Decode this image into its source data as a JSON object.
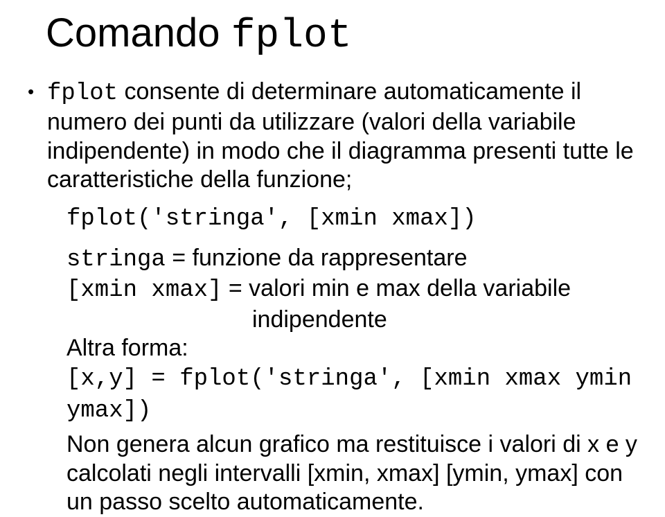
{
  "title_prefix": "Comando ",
  "title_code": "fplot",
  "bullet": {
    "lead_code": "fplot",
    "lead_rest": " consente di determinare automaticamente il numero dei punti da utilizzare (valori della variabile indipendente) in modo che il diagramma presenti tutte le caratteristiche della funzione;",
    "syntax1": "fplot('stringa', [xmin xmax])",
    "stringa_code": "stringa",
    "stringa_rest": " = funzione da rappresentare",
    "xminxmax_code": "[xmin xmax]",
    "xminxmax_rest": " = valori min e max della variabile",
    "xminxmax_line2": "indipendente",
    "altra_forma": "Altra forma:",
    "syntax2": "[x,y] = fplot('stringa', [xmin xmax ymin ymax])",
    "tail": "Non genera alcun grafico ma restituisce i valori di x e y calcolati negli intervalli [xmin, xmax] [ymin, ymax] con un passo scelto automaticamente."
  }
}
